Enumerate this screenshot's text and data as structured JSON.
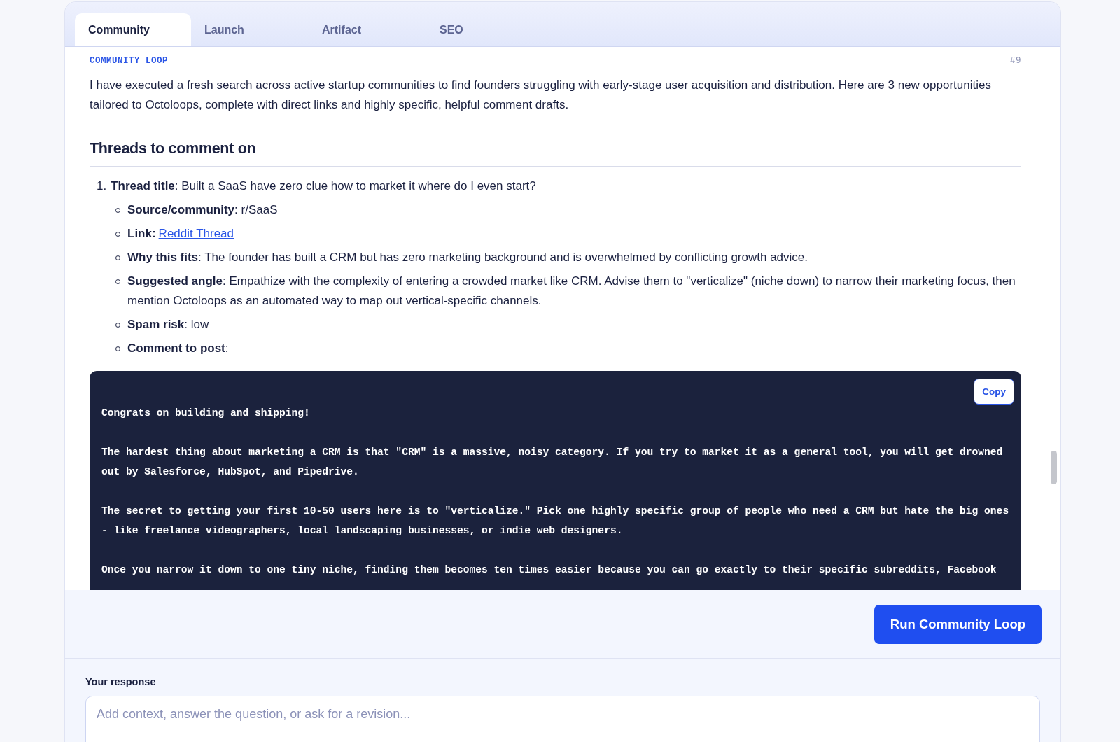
{
  "tabs": [
    {
      "label": "Community",
      "selected": true
    },
    {
      "label": "Launch",
      "selected": false
    },
    {
      "label": "Artifact",
      "selected": false
    },
    {
      "label": "SEO",
      "selected": false
    }
  ],
  "section_label": "COMMUNITY LOOP",
  "message_number": "#9",
  "intro": "I have executed a fresh search across active startup communities to find founders struggling with early-stage user acquisition and distribution. Here are 3 new opportunities tailored to Octoloops, complete with direct links and highly specific, helpful comment drafts.",
  "heading": "Threads to comment on",
  "threads": [
    {
      "number": "1.",
      "title": "**Thread title**: Built a SaaS have zero clue how to market it where do I even start?",
      "details": [
        {
          "kind": "text",
          "text": "**Source/community**: r/SaaS"
        },
        {
          "kind": "link",
          "label": "Link:",
          "link_text": "Reddit Thread"
        },
        {
          "kind": "text",
          "text": "**Why this fits**: The founder has built a CRM but has zero marketing background and is overwhelmed by conflicting growth advice."
        },
        {
          "kind": "text",
          "text": "**Suggested angle**: Empathize with the complexity of entering a crowded market like CRM. Advise them to \"verticalize\" (niche down) to narrow their marketing focus, then mention Octoloops as an automated way to map out vertical-specific channels."
        },
        {
          "kind": "text",
          "text": "**Spam risk**: low"
        },
        {
          "kind": "text",
          "text": "**Comment to post**:"
        }
      ]
    }
  ],
  "code_block": {
    "copy_label": "Copy",
    "paragraphs": [
      [
        "Congrats on building and shipping!"
      ],
      [
        "The hardest thing about marketing a CRM is that \"CRM\" is a massive, noisy category. If you try to market it as a general tool, you will get drowned",
        "out by Salesforce, HubSpot, and Pipedrive."
      ],
      [
        "The secret to getting your first 10-50 users here is to \"verticalize.\" Pick one highly specific group of people who need a CRM but hate the big ones",
        "- like freelance videographers, local landscaping businesses, or indie web designers."
      ],
      [
        "Once you narrow it down to one tiny niche, finding them becomes ten times easier because you can go exactly to their specific subreddits, Facebook"
      ]
    ]
  },
  "run_button": "Run Community Loop",
  "response": {
    "label": "Your response",
    "placeholder": "Add context, answer the question, or ask for a revision..."
  }
}
